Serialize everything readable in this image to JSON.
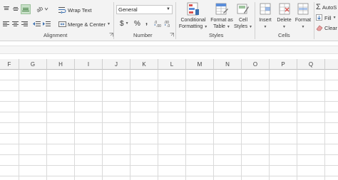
{
  "alignment": {
    "wrap_text": "Wrap Text",
    "merge_center": "Merge & Center",
    "group_label": "Alignment"
  },
  "number": {
    "format_value": "General",
    "currency_symbol": "$",
    "percent_symbol": "%",
    "comma_symbol": ",",
    "group_label": "Number"
  },
  "styles": {
    "conditional_formatting": [
      "Conditional",
      "Formatting"
    ],
    "format_as_table": [
      "Format as",
      "Table"
    ],
    "cell_styles": [
      "Cell",
      "Styles"
    ],
    "group_label": "Styles"
  },
  "cells": {
    "insert": "Insert",
    "delete": "Delete",
    "format": "Format",
    "group_label": "Cells"
  },
  "editing": {
    "autosum": "AutoS",
    "fill": "Fill",
    "clear": "Clear"
  },
  "sheet": {
    "columns": [
      "F",
      "G",
      "H",
      "I",
      "J",
      "K",
      "L",
      "M",
      "N",
      "O",
      "P",
      "Q"
    ]
  }
}
